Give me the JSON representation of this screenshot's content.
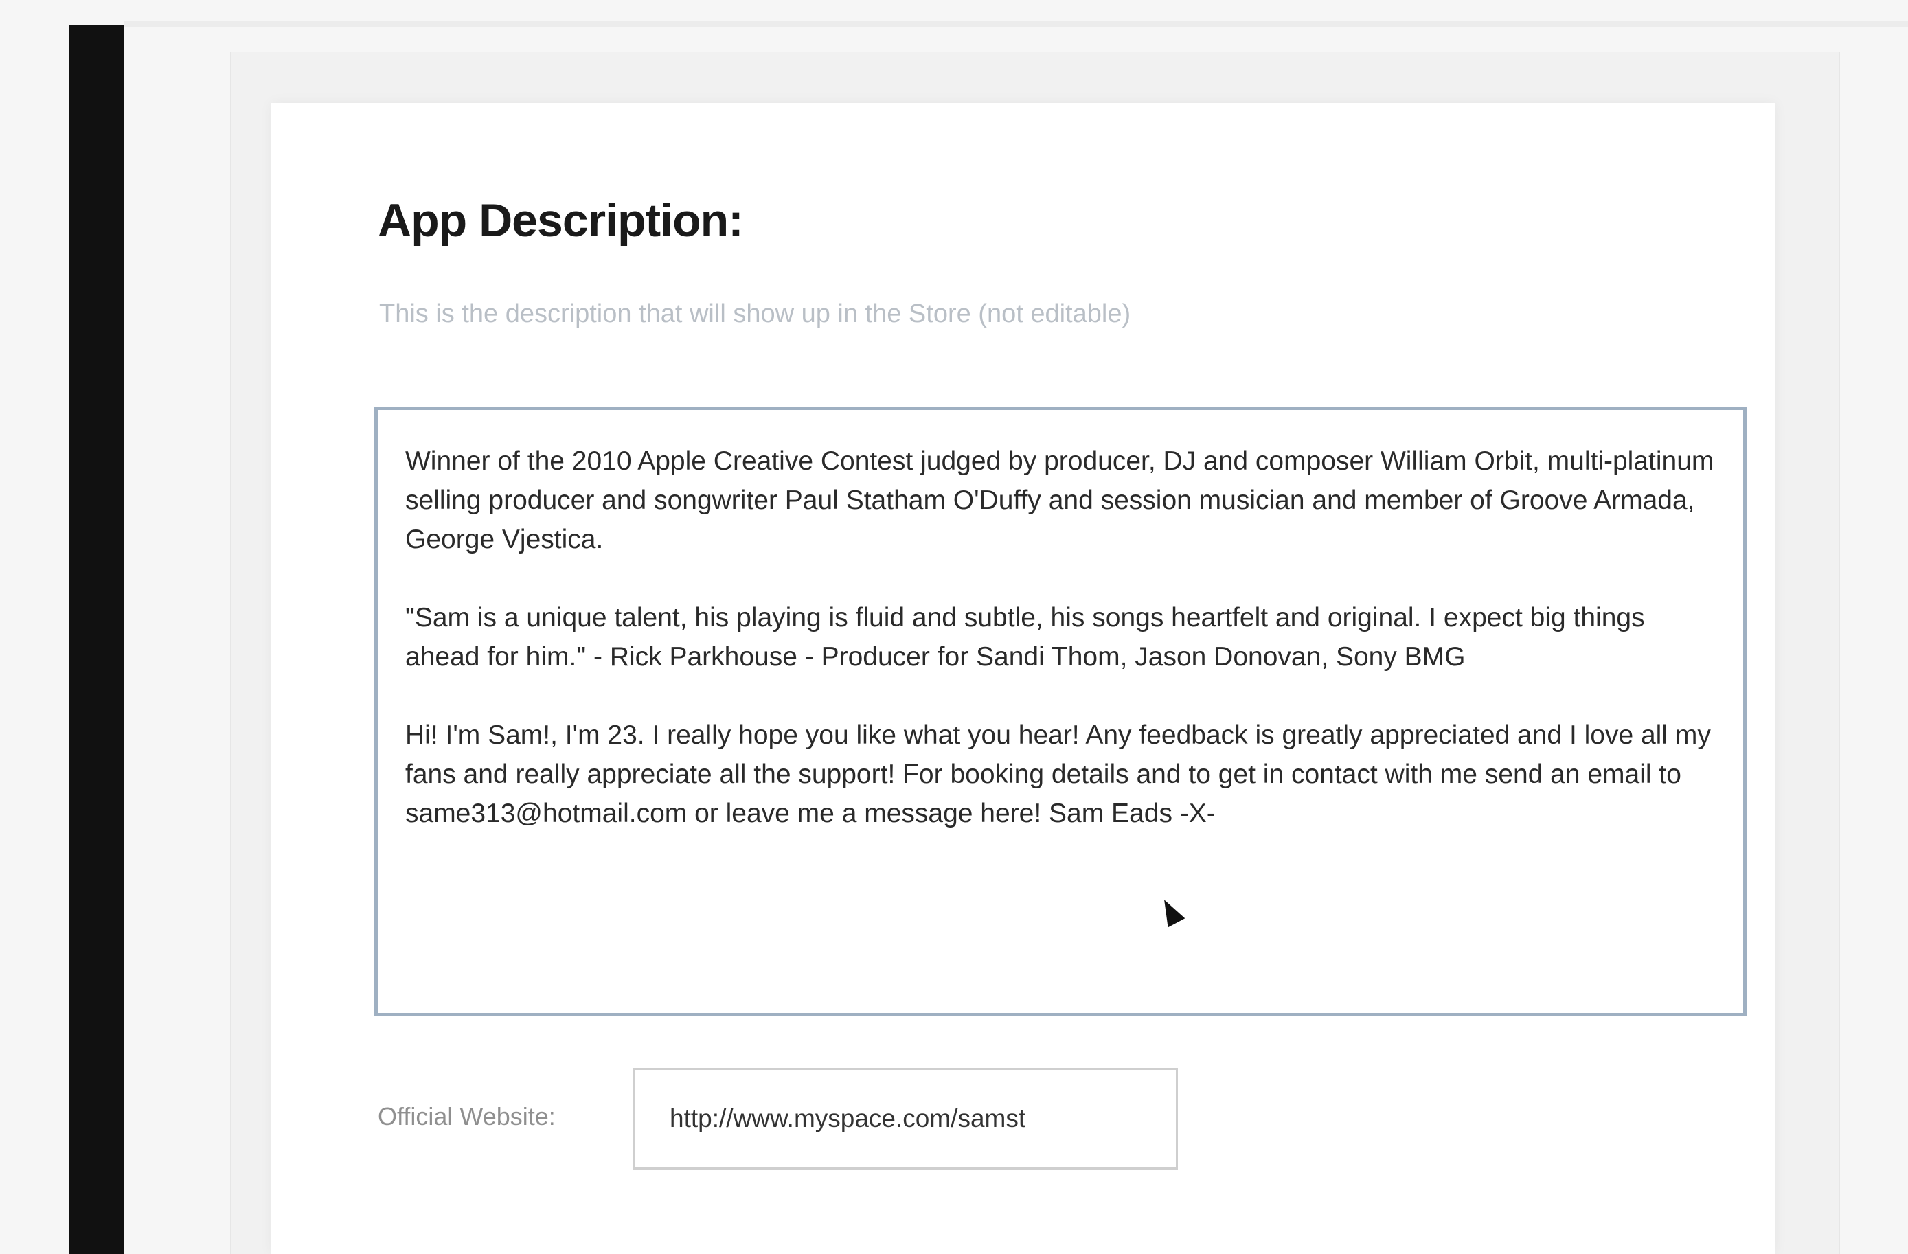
{
  "page": {
    "title": "App Description:",
    "subtitle": "This is the description that will show up in the Store (not editable)"
  },
  "description": {
    "paragraphs": [
      "Winner of the 2010 Apple Creative Contest judged by producer, DJ and composer William Orbit, multi-platinum selling producer and songwriter Paul Statham O'Duffy and session musician and member of Groove Armada, George Vjestica.",
      "\"Sam is a unique talent, his playing is fluid and subtle, his songs heartfelt and original. I expect big things ahead for him.\" - Rick Parkhouse - Producer for Sandi Thom, Jason Donovan, Sony BMG",
      "Hi! I'm Sam!, I'm 23. I really hope you like what you hear! Any feedback is greatly appreciated and I love all my fans and really appreciate all the support! For booking details and to get in contact with me send an email to same313@hotmail.com or leave me a message here! Sam Eads -X-"
    ]
  },
  "website": {
    "label": "Official Website:",
    "value": "http://www.myspace.com/samst"
  }
}
